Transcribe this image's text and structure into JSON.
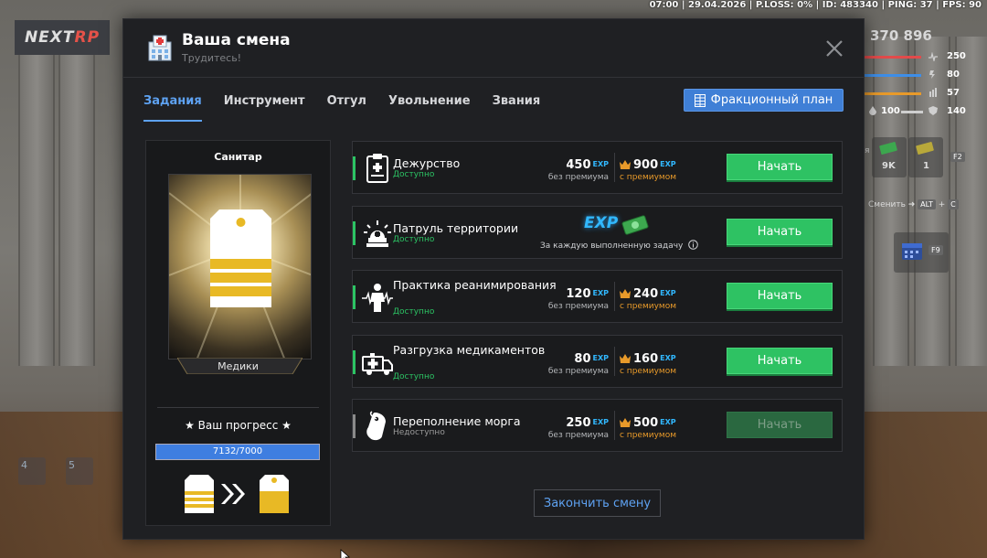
{
  "status_bar": "07:00 | 29.04.2026 | P.LOSS: 0% | ID: 483340 | PING: 37 | FPS: 90",
  "logo": {
    "part1": "NEXT",
    "part2": "RP"
  },
  "hud": {
    "money": "370 896",
    "stats": [
      {
        "icon": "heart-rate-icon",
        "value": "250",
        "color": "#e24b4b"
      },
      {
        "icon": "armor-icon",
        "value": "80",
        "color": "#3e8ee8"
      },
      {
        "icon": "ammo-icon",
        "value": "57",
        "color": "#e89a2a"
      },
      {
        "icon": "shield-icon",
        "value": "140",
        "color": "#cfcfcf"
      }
    ],
    "stat_100": "100",
    "counters": [
      {
        "label": "9K"
      },
      {
        "label": "1"
      }
    ],
    "key_f2": "F2",
    "switch_label": "Сменить",
    "key_alt": "ALT",
    "key_c": "C",
    "key_f9": "F9"
  },
  "modal": {
    "title": "Ваша смена",
    "subtitle": "Трудитесь!",
    "tabs": [
      "Задания",
      "Инструмент",
      "Отгул",
      "Увольнение",
      "Звания"
    ],
    "active_tab": 0,
    "plan_button": "Фракционный план",
    "rank": {
      "name": "Санитар",
      "category": "Медики",
      "progress_label": "★ Ваш прогресс ★",
      "progress_current": 7132,
      "progress_max": 7000,
      "progress_text": "7132/7000"
    },
    "tasks": [
      {
        "name": "Дежурство",
        "status": "Доступно",
        "icon": "clipboard-icon",
        "exp": "450",
        "exp_label": "без премиума",
        "prem_exp": "900",
        "prem_label": "с премиумом",
        "button": "Начать",
        "available": true
      },
      {
        "name": "Патруль территории",
        "status": "Доступно",
        "icon": "ambulance-siren-icon",
        "special": true,
        "special_note": "За каждую выполненную задачу",
        "button": "Начать",
        "available": true
      },
      {
        "name": "Практика реанимирования",
        "status": "Доступно",
        "icon": "reanimation-icon",
        "exp": "120",
        "exp_label": "без премиума",
        "prem_exp": "240",
        "prem_label": "с премиумом",
        "button": "Начать",
        "available": true
      },
      {
        "name": "Разгрузка медикаментов",
        "status": "Доступно",
        "icon": "ambulance-icon",
        "exp": "80",
        "exp_label": "без премиума",
        "prem_exp": "160",
        "prem_label": "с премиумом",
        "button": "Начать",
        "available": true
      },
      {
        "name": "Переполнение морга",
        "status": "Недоступно",
        "icon": "morgue-tag-icon",
        "exp": "250",
        "exp_label": "без премиума",
        "prem_exp": "500",
        "prem_label": "с премиумом",
        "button": "Начать",
        "available": false
      }
    ],
    "exp_tag": "EXP",
    "finish_button": "Закончить смену"
  }
}
